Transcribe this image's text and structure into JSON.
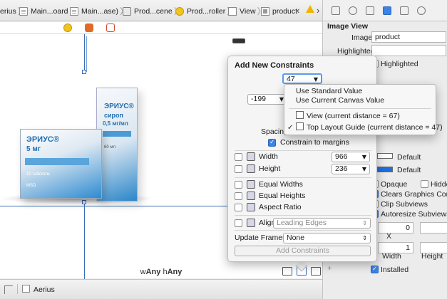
{
  "jumpbar": {
    "crumbs": [
      {
        "label": "erius",
        "icon": "folder-icon"
      },
      {
        "label": "Main...oard",
        "icon": "storyboard-icon"
      },
      {
        "label": "Main...ase)",
        "icon": "storyboard-icon"
      },
      {
        "label": "Prod...cene",
        "icon": "scene-icon"
      },
      {
        "label": "Prod...roller",
        "icon": "controller-icon"
      },
      {
        "label": "View",
        "icon": "view-icon"
      },
      {
        "label": "product",
        "icon": "image-view-icon"
      }
    ]
  },
  "canvas": {
    "size_class_w": "w",
    "size_class_w_val": "Any",
    "size_class_h": "h",
    "size_class_h_val": "Any"
  },
  "product_image": {
    "back_brand": "ЭРИУС®",
    "back_line1": "сироп",
    "back_line2": "0,5 мг/мл",
    "back_volume": "60 мл",
    "front_brand": "ЭРИУС®",
    "front_dose": "5 мг",
    "front_count": "10 таблеток",
    "maker": "MSD"
  },
  "bottombar": {
    "scene_label": "Aerius"
  },
  "popover": {
    "title": "Add New Constraints",
    "top_value": "47",
    "left_value": "-199",
    "spacing_label": "Spacing",
    "constrain_margins": "Constrain to margins",
    "width_label": "Width",
    "width_value": "966",
    "height_label": "Height",
    "height_value": "236",
    "equal_widths": "Equal Widths",
    "equal_heights": "Equal Heights",
    "aspect_ratio": "Aspect Ratio",
    "align_label": "Align",
    "align_value": "Leading Edges",
    "update_frames_label": "Update Frames",
    "update_frames_value": "None",
    "add_button": "Add Constraints"
  },
  "menu": {
    "items": [
      "Use Standard Value",
      "Use Current Canvas Value",
      "View (current distance = 67)",
      "Top Layout Guide (current distance = 47)"
    ]
  },
  "inspector": {
    "section_title": "Image View",
    "image_label": "Image",
    "image_value": "product",
    "highlighted_label": "Highlighted",
    "highlighted_cb": "Highlighted",
    "default_1": "Default",
    "default_2": "Default",
    "opaque": "Opaque",
    "hidden": "Hidde",
    "clears": "Clears Graphics Conte",
    "clip": "Clip Subviews",
    "autoresize": "Autoresize Subviews",
    "x_value": "0",
    "x_label": "X",
    "width_value": "1",
    "width_label": "Width",
    "height_label": "Height",
    "installed": "Installed",
    "plus": "+"
  }
}
